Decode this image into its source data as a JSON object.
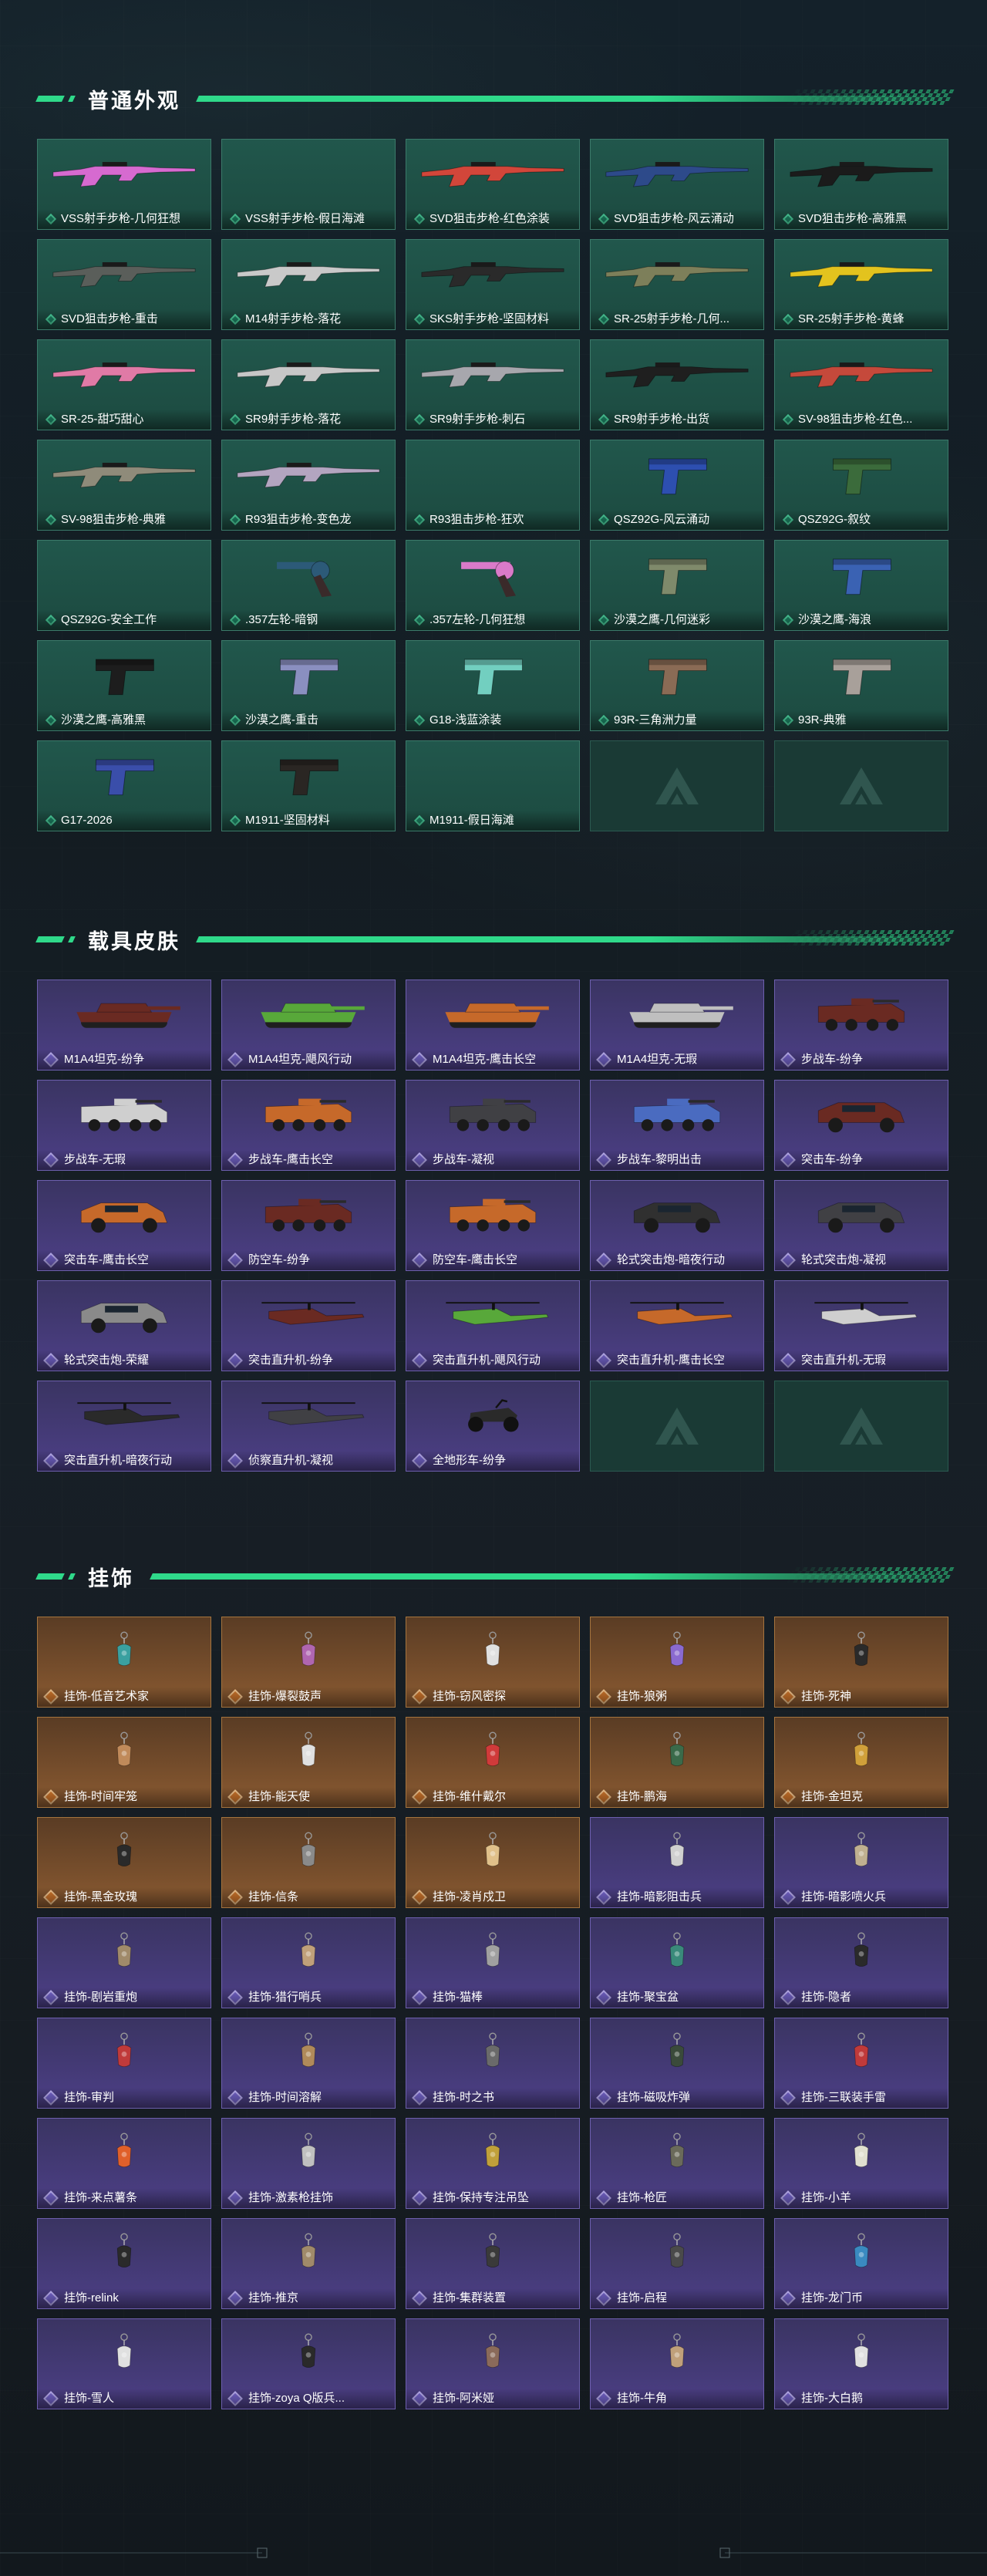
{
  "sections": [
    {
      "title": "普通外观",
      "theme": "green",
      "items": [
        {
          "label": "VSS射手步枪-几何狂想",
          "art": "rifle",
          "color": "#d66ad0"
        },
        {
          "label": "VSS射手步枪-假日海滩",
          "art": "none",
          "color": "#2a6b5c"
        },
        {
          "label": "SVD狙击步枪-红色涂装",
          "art": "rifle",
          "color": "#d2463a"
        },
        {
          "label": "SVD狙击步枪-风云涌动",
          "art": "rifle",
          "color": "#2d4a8a"
        },
        {
          "label": "SVD狙击步枪-高雅黑",
          "art": "rifle",
          "color": "#1b1b1b"
        },
        {
          "label": "SVD狙击步枪-重击",
          "art": "rifle",
          "color": "#5a5e5a"
        },
        {
          "label": "M14射手步枪-落花",
          "art": "rifle",
          "color": "#c9c9c9"
        },
        {
          "label": "SKS射手步枪-坚固材料",
          "art": "rifle",
          "color": "#2a2a2a"
        },
        {
          "label": "SR-25射手步枪-几何...",
          "art": "rifle",
          "color": "#7d7f5a"
        },
        {
          "label": "SR-25射手步枪-黄蜂",
          "art": "rifle",
          "color": "#e3c31e"
        },
        {
          "label": "SR-25-甜巧甜心",
          "art": "rifle",
          "color": "#e07aa6"
        },
        {
          "label": "SR9射手步枪-落花",
          "art": "rifle",
          "color": "#c7c7c7"
        },
        {
          "label": "SR9射手步枪-刺石",
          "art": "rifle",
          "color": "#a7a7ad"
        },
        {
          "label": "SR9射手步枪-出货",
          "art": "rifle",
          "color": "#1f1f1f"
        },
        {
          "label": "SV-98狙击步枪-红色...",
          "art": "rifle",
          "color": "#c5493b"
        },
        {
          "label": "SV-98狙击步枪-典雅",
          "art": "rifle",
          "color": "#8f8b7a"
        },
        {
          "label": "R93狙击步枪-变色龙",
          "art": "rifle",
          "color": "#b3a5c0"
        },
        {
          "label": "R93狙击步枪-狂欢",
          "art": "none",
          "color": "#2a6b5c"
        },
        {
          "label": "QSZ92G-风云涌动",
          "art": "pistol",
          "color": "#2d4fb0"
        },
        {
          "label": "QSZ92G-叙纹",
          "art": "pistol",
          "color": "#3b6b3b"
        },
        {
          "label": "QSZ92G-安全工作",
          "art": "none",
          "color": "#2a6b5c"
        },
        {
          "label": ".357左轮-暗钢",
          "art": "revolver",
          "color": "#2c5a78"
        },
        {
          "label": ".357左轮-几何狂想",
          "art": "revolver",
          "color": "#d97ac9"
        },
        {
          "label": "沙漠之鹰-几何迷彩",
          "art": "pistol",
          "color": "#7f8a6b"
        },
        {
          "label": "沙漠之鹰-海浪",
          "art": "pistol",
          "color": "#3a62b3"
        },
        {
          "label": "沙漠之鹰-高雅黑",
          "art": "pistol",
          "color": "#1d1d1d"
        },
        {
          "label": "沙漠之鹰-重击",
          "art": "pistol",
          "color": "#8a8fc0"
        },
        {
          "label": "G18-浅蓝涂装",
          "art": "pistol",
          "color": "#72cfc0"
        },
        {
          "label": "93R-三角洲力量",
          "art": "pistol",
          "color": "#8a6b55"
        },
        {
          "label": "93R-典雅",
          "art": "pistol",
          "color": "#a8a09a"
        },
        {
          "label": "G17-2026",
          "art": "pistol",
          "color": "#3a4eaa"
        },
        {
          "label": "M1911-坚固材料",
          "art": "pistol",
          "color": "#2a2623"
        },
        {
          "label": "M1911-假日海滩",
          "art": "none",
          "color": "#2a6b5c"
        },
        {
          "label": "",
          "art": "logo",
          "color": ""
        },
        {
          "label": "",
          "art": "logo",
          "color": ""
        }
      ]
    },
    {
      "title": "载具皮肤",
      "theme": "purple",
      "items": [
        {
          "label": "M1A4坦克-纷争",
          "art": "tank",
          "color": "#6a2a22"
        },
        {
          "label": "M1A4坦克-飓风行动",
          "art": "tank",
          "color": "#58a83a"
        },
        {
          "label": "M1A4坦克-鹰击长空",
          "art": "tank",
          "color": "#c6692a"
        },
        {
          "label": "M1A4坦克-无瑕",
          "art": "tank",
          "color": "#bfbfbf"
        },
        {
          "label": "步战车-纷争",
          "art": "apc",
          "color": "#6a2a22"
        },
        {
          "label": "步战车-无瑕",
          "art": "apc",
          "color": "#cfcfcf"
        },
        {
          "label": "步战车-鹰击长空",
          "art": "apc",
          "color": "#c6692a"
        },
        {
          "label": "步战车-凝视",
          "art": "apc",
          "color": "#404044"
        },
        {
          "label": "步战车-黎明出击",
          "art": "apc",
          "color": "#4a6bc0"
        },
        {
          "label": "突击车-纷争",
          "art": "jeep",
          "color": "#6a2a22"
        },
        {
          "label": "突击车-鹰击长空",
          "art": "jeep",
          "color": "#c6692a"
        },
        {
          "label": "防空车-纷争",
          "art": "apc",
          "color": "#6a2a22"
        },
        {
          "label": "防空车-鹰击长空",
          "art": "apc",
          "color": "#c6692a"
        },
        {
          "label": "轮式突击炮-暗夜行动",
          "art": "jeep",
          "color": "#303030"
        },
        {
          "label": "轮式突击炮-凝视",
          "art": "jeep",
          "color": "#404044"
        },
        {
          "label": "轮式突击炮-荣耀",
          "art": "jeep",
          "color": "#8a8a8a"
        },
        {
          "label": "突击直升机-纷争",
          "art": "heli",
          "color": "#6a2a22"
        },
        {
          "label": "突击直升机-飓风行动",
          "art": "heli",
          "color": "#58a83a"
        },
        {
          "label": "突击直升机-鹰击长空",
          "art": "heli",
          "color": "#c6692a"
        },
        {
          "label": "突击直升机-无瑕",
          "art": "heli",
          "color": "#cfcfcf"
        },
        {
          "label": "突击直升机-暗夜行动",
          "art": "heli",
          "color": "#2a2a2a"
        },
        {
          "label": "侦察直升机-凝视",
          "art": "heli",
          "color": "#404044"
        },
        {
          "label": "全地形车-纷争",
          "art": "atv",
          "color": "#2a2a2a"
        },
        {
          "label": "",
          "art": "logo",
          "color": ""
        },
        {
          "label": "",
          "art": "logo",
          "color": ""
        }
      ]
    },
    {
      "title": "挂饰",
      "theme": "mixed",
      "items": [
        {
          "label": "挂饰-低音艺术家",
          "art": "charm",
          "color": "#3aa0a0",
          "tier": "orange"
        },
        {
          "label": "挂饰-爆裂鼓声",
          "art": "charm",
          "color": "#b066b0",
          "tier": "orange"
        },
        {
          "label": "挂饰-窃风密探",
          "art": "charm",
          "color": "#e0e0e0",
          "tier": "orange"
        },
        {
          "label": "挂饰-狼粥",
          "art": "charm",
          "color": "#8a6ad0",
          "tier": "orange"
        },
        {
          "label": "挂饰-死神",
          "art": "charm",
          "color": "#2a2a2a",
          "tier": "orange"
        },
        {
          "label": "挂饰-时间牢笼",
          "art": "charm",
          "color": "#c08a5a",
          "tier": "orange"
        },
        {
          "label": "挂饰-能天使",
          "art": "charm",
          "color": "#e0e0e0",
          "tier": "orange"
        },
        {
          "label": "挂饰-维什戴尔",
          "art": "charm",
          "color": "#d03a3a",
          "tier": "orange"
        },
        {
          "label": "挂饰-鹏海",
          "art": "charm",
          "color": "#3a6a4a",
          "tier": "orange"
        },
        {
          "label": "挂饰-金坦克",
          "art": "charm",
          "color": "#d0a03a",
          "tier": "orange"
        },
        {
          "label": "挂饰-黑金玫瑰",
          "art": "charm",
          "color": "#2a2a2a",
          "tier": "orange"
        },
        {
          "label": "挂饰-信条",
          "art": "charm",
          "color": "#8a8a8a",
          "tier": "orange"
        },
        {
          "label": "挂饰-凌肖戍卫",
          "art": "charm",
          "color": "#e0c08a",
          "tier": "orange"
        },
        {
          "label": "挂饰-暗影阻击兵",
          "art": "charm",
          "color": "#d0d0d0",
          "tier": "purple"
        },
        {
          "label": "挂饰-暗影喷火兵",
          "art": "charm",
          "color": "#c0b090",
          "tier": "purple"
        },
        {
          "label": "挂饰-剧岩重炮",
          "art": "charm",
          "color": "#a08a6a",
          "tier": "purple"
        },
        {
          "label": "挂饰-猎行哨兵",
          "art": "charm",
          "color": "#c0a07a",
          "tier": "purple"
        },
        {
          "label": "挂饰-猫棒",
          "art": "charm",
          "color": "#a0a0a0",
          "tier": "purple"
        },
        {
          "label": "挂饰-聚宝盆",
          "art": "charm",
          "color": "#3a8a7a",
          "tier": "purple"
        },
        {
          "label": "挂饰-隐者",
          "art": "charm",
          "color": "#2a2a2a",
          "tier": "purple"
        },
        {
          "label": "挂饰-审判",
          "art": "charm",
          "color": "#c03a3a",
          "tier": "purple"
        },
        {
          "label": "挂饰-时间溶解",
          "art": "charm",
          "color": "#b08a5a",
          "tier": "purple"
        },
        {
          "label": "挂饰-时之书",
          "art": "charm",
          "color": "#6a6a6a",
          "tier": "purple"
        },
        {
          "label": "挂饰-磁吸炸弹",
          "art": "charm",
          "color": "#3a4a3a",
          "tier": "purple"
        },
        {
          "label": "挂饰-三联装手雷",
          "art": "charm",
          "color": "#c03a3a",
          "tier": "purple"
        },
        {
          "label": "挂饰-来点薯条",
          "art": "charm",
          "color": "#e0602a",
          "tier": "purple"
        },
        {
          "label": "挂饰-激素枪挂饰",
          "art": "charm",
          "color": "#c0c0c0",
          "tier": "purple"
        },
        {
          "label": "挂饰-保持专注吊坠",
          "art": "charm",
          "color": "#c0a03a",
          "tier": "purple"
        },
        {
          "label": "挂饰-枪匠",
          "art": "charm",
          "color": "#6a6a5a",
          "tier": "purple"
        },
        {
          "label": "挂饰-小羊",
          "art": "charm",
          "color": "#e0e0d0",
          "tier": "purple"
        },
        {
          "label": "挂饰-relink",
          "art": "charm",
          "color": "#2a2a2a",
          "tier": "purple"
        },
        {
          "label": "挂饰-推京",
          "art": "charm",
          "color": "#a08a6a",
          "tier": "purple"
        },
        {
          "label": "挂饰-集群装置",
          "art": "charm",
          "color": "#3a3a3a",
          "tier": "purple"
        },
        {
          "label": "挂饰-启程",
          "art": "charm",
          "color": "#4a4a4a",
          "tier": "purple"
        },
        {
          "label": "挂饰-龙门币",
          "art": "charm",
          "color": "#3a8ac0",
          "tier": "purple"
        },
        {
          "label": "挂饰-雪人",
          "art": "charm",
          "color": "#e0e0e0",
          "tier": "purple"
        },
        {
          "label": "挂饰-zoya Q版兵...",
          "art": "charm",
          "color": "#2a2a2a",
          "tier": "purple"
        },
        {
          "label": "挂饰-阿米娅",
          "art": "charm",
          "color": "#8a6a5a",
          "tier": "purple"
        },
        {
          "label": "挂饰-牛角",
          "art": "charm",
          "color": "#c0a07a",
          "tier": "purple"
        },
        {
          "label": "挂饰-大白鹅",
          "art": "charm",
          "color": "#e0e0e0",
          "tier": "purple"
        }
      ]
    }
  ],
  "colors": {
    "accent": "#2fd98a",
    "green_card": "#21574c",
    "purple_card": "#4c3f86",
    "orange_card": "#8a5a31"
  }
}
